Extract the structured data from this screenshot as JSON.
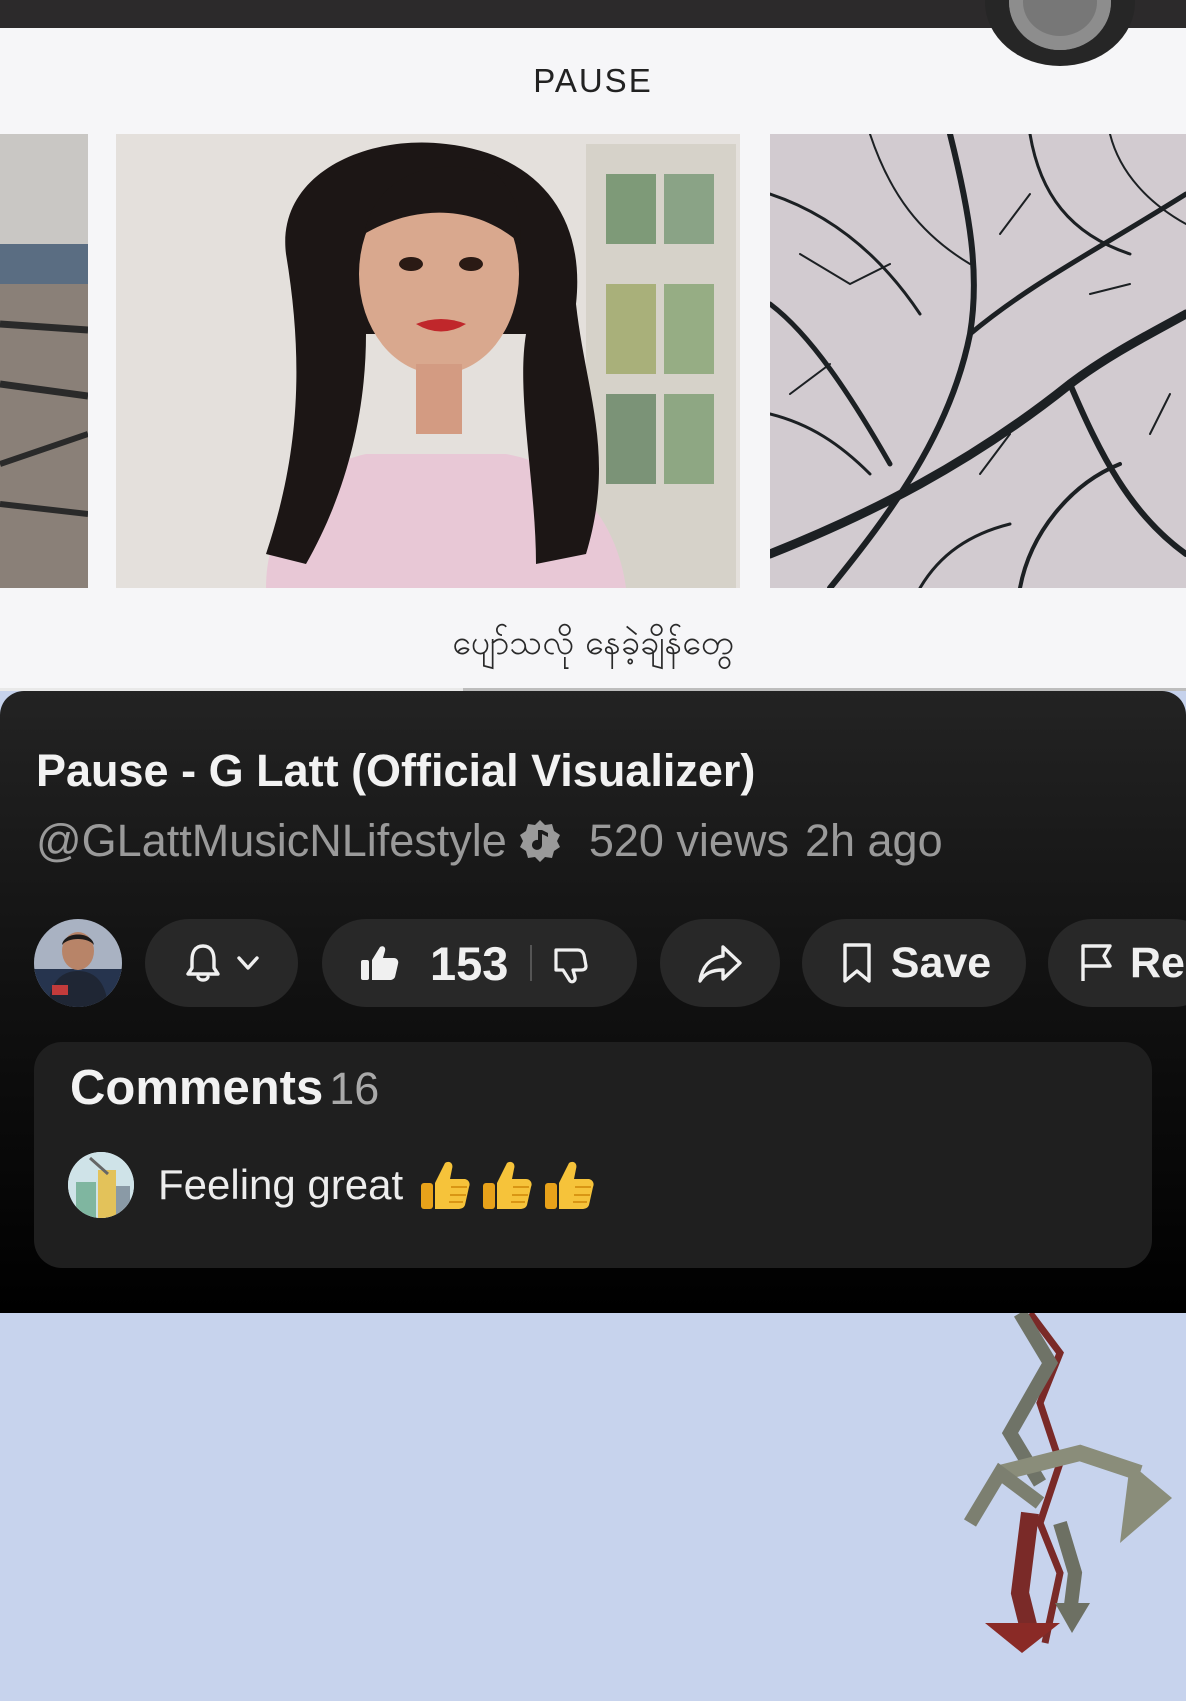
{
  "video": {
    "overlay_title": "PAUSE",
    "subtitle": "ပျော်သလို နေခဲ့ချိန်တွေ",
    "progress": 0.39
  },
  "info": {
    "title": "Pause - G Latt (Official Visualizer)",
    "channel": "@GLattMusicNLifestyle",
    "views": "520 views",
    "age": "2h ago"
  },
  "actions": {
    "likes": "153",
    "save_label": "Save",
    "report_label": "Re"
  },
  "comments": {
    "label": "Comments",
    "count": "16",
    "top_comment": "Feeling great"
  },
  "icons": [
    "record-icon",
    "bell-icon",
    "chevron-down-icon",
    "like-icon",
    "dislike-icon",
    "share-icon",
    "bookmark-icon",
    "flag-icon",
    "verified-music-icon",
    "thumbs-up-emoji"
  ]
}
